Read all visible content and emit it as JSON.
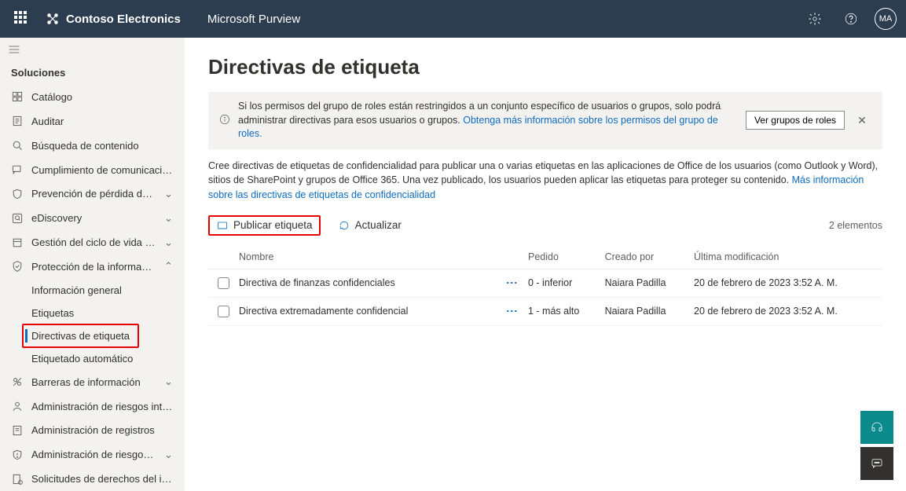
{
  "header": {
    "org": "Contoso Electronics",
    "product": "Microsoft Purview",
    "avatar": "MA"
  },
  "sidebar": {
    "section": "Soluciones",
    "items": [
      {
        "icon": "catalog",
        "label": "Catálogo"
      },
      {
        "icon": "audit",
        "label": "Auditar"
      },
      {
        "icon": "search",
        "label": "Búsqueda de contenido"
      },
      {
        "icon": "comm",
        "label": "Cumplimiento de comunicacio..."
      },
      {
        "icon": "dlp",
        "label": "Prevención de pérdida de datos",
        "chev": true
      },
      {
        "icon": "ed",
        "label": "eDiscovery",
        "chev": true
      },
      {
        "icon": "lifecycle",
        "label": "Gestión del ciclo de vida de los...",
        "chev": true
      },
      {
        "icon": "protect",
        "label": "Protección de la información",
        "chev": true,
        "expanded": true,
        "subs": [
          {
            "label": "Información general"
          },
          {
            "label": "Etiquetas"
          },
          {
            "label": "Directivas de etiqueta",
            "active": true
          },
          {
            "label": "Etiquetado automático"
          }
        ]
      },
      {
        "icon": "barrier",
        "label": "Barreras de información",
        "chev": true
      },
      {
        "icon": "risk",
        "label": "Administración de riesgos inte..."
      },
      {
        "icon": "records",
        "label": "Administración de registros"
      },
      {
        "icon": "risk2",
        "label": "Administración de riesgos de ...",
        "chev": true
      },
      {
        "icon": "rights",
        "label": "Solicitudes de derechos del int..."
      }
    ]
  },
  "page": {
    "title": "Directivas de etiqueta",
    "info_text1": "Si los permisos del grupo de roles están restringidos a un conjunto específico de usuarios o grupos, solo podrá administrar directivas para esos usuarios o grupos. ",
    "info_link": "Obtenga más información sobre los permisos del grupo de roles.",
    "info_button": "Ver grupos de roles",
    "desc1": "Cree directivas de etiquetas de confidencialidad para publicar una o varias etiquetas en las aplicaciones de Office de los usuarios (como Outlook y Word), sitios de SharePoint y grupos de Office 365. Una vez publicado, los usuarios pueden aplicar las etiquetas para proteger su contenido. ",
    "desc_link": "Más información sobre las directivas de etiquetas de confidencialidad",
    "cmd_publish": "Publicar etiqueta",
    "cmd_refresh": "Actualizar",
    "count": "2 elementos",
    "cols": {
      "name": "Nombre",
      "order": "Pedido",
      "created": "Creado por",
      "modified": "Última modificación"
    },
    "rows": [
      {
        "name": "Directiva de finanzas confidenciales",
        "order": "0 - inferior",
        "created": "Naiara Padilla",
        "modified": "20 de febrero de 2023 3:52 A. M."
      },
      {
        "name": "Directiva extremadamente confidencial",
        "order": "1 - más alto",
        "created": "Naiara Padilla",
        "modified": "20 de febrero de 2023 3:52 A. M."
      }
    ]
  }
}
